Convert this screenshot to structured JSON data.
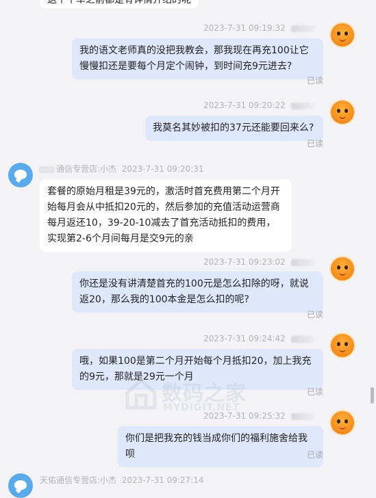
{
  "top_partial": {
    "text": "这个个单之前都是有详情介绍的呢"
  },
  "messages": [
    {
      "meta": "2023-7-31 09:19:32",
      "text": "我的语文老师真的没把我教会，那我现在再充100让它慢慢扣还是要每个月定个闹钟，到时间充9元进去?",
      "status": "已读"
    },
    {
      "meta": "2023-7-31 09:20:22",
      "text": "我莫名其妙被扣的37元还能要回来么?",
      "status": "已读"
    },
    {
      "sender": "通信专营店:小杰",
      "meta": "2023-7-31 09:20:31",
      "text": "套餐的原始月租是39元的，激活时首充费用第二个月开始每月会从中抵扣20元的，然后参加的充值活动运营商每月返还10，39-20-10减去了首充活动抵扣的费用，实现第2-6个月间每月是交9元的亲"
    },
    {
      "meta": "2023-7-31 09:23:02",
      "text": "你还是没有讲清楚首充的100元是怎么扣除的呀，就说返20，那么我的100本金是怎么扣的呢?",
      "status": "已读"
    },
    {
      "meta": "2023-7-31 09:24:42",
      "text": "哦，如果100是第二个月开始每个月抵扣20，加上我充的9元，那就是29元一个月",
      "status": "已读"
    },
    {
      "meta": "2023-7-31 09:25:32",
      "text": "你们是把我充的钱当成你们的福利施舍给我呗",
      "status": "已读"
    },
    {
      "sender": "天佑通信专营店:小杰",
      "meta": "2023-7-31 09:27:14"
    }
  ],
  "watermark": {
    "main": "数码之家",
    "sub": "MYDIGIT.NET"
  },
  "icons": {
    "out_avatar": "orange-mascot-avatar-icon",
    "in_avatar": "blue-chat-avatar-icon",
    "watermark": "house-logo-icon"
  }
}
